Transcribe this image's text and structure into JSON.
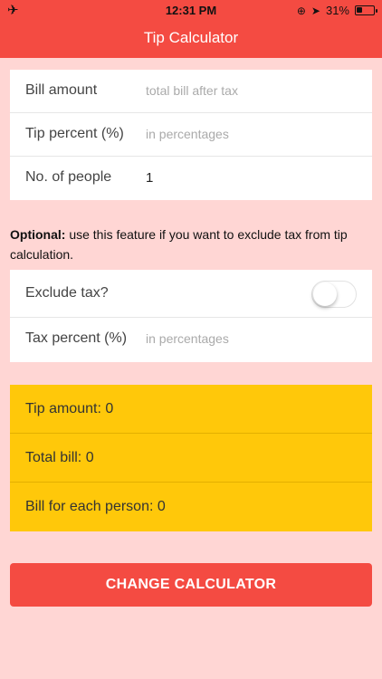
{
  "status_bar": {
    "time": "12:31 PM",
    "battery": "31%",
    "battery_level": 0.31
  },
  "nav": {
    "title": "Tip Calculator"
  },
  "inputs": {
    "bill": {
      "label": "Bill amount",
      "placeholder": "total bill after tax"
    },
    "tip": {
      "label": "Tip percent (%)",
      "placeholder": "in percentages"
    },
    "people": {
      "label": "No. of people",
      "value": "1"
    }
  },
  "note": {
    "bold": "Optional:",
    "text": " use this feature if you want to exclude tax from tip calculation."
  },
  "tax": {
    "exclude_label": "Exclude tax?",
    "exclude_on": false,
    "percent_label": "Tax percent (%)",
    "percent_placeholder": "in percentages"
  },
  "results": {
    "tip": "Tip amount: 0",
    "total": "Total bill: 0",
    "each": "Bill for each person: 0"
  },
  "button": {
    "label": "CHANGE CALCULATOR"
  },
  "colors": {
    "accent": "#f44b42",
    "background": "#ffd6d4",
    "results": "#ffc80a"
  }
}
